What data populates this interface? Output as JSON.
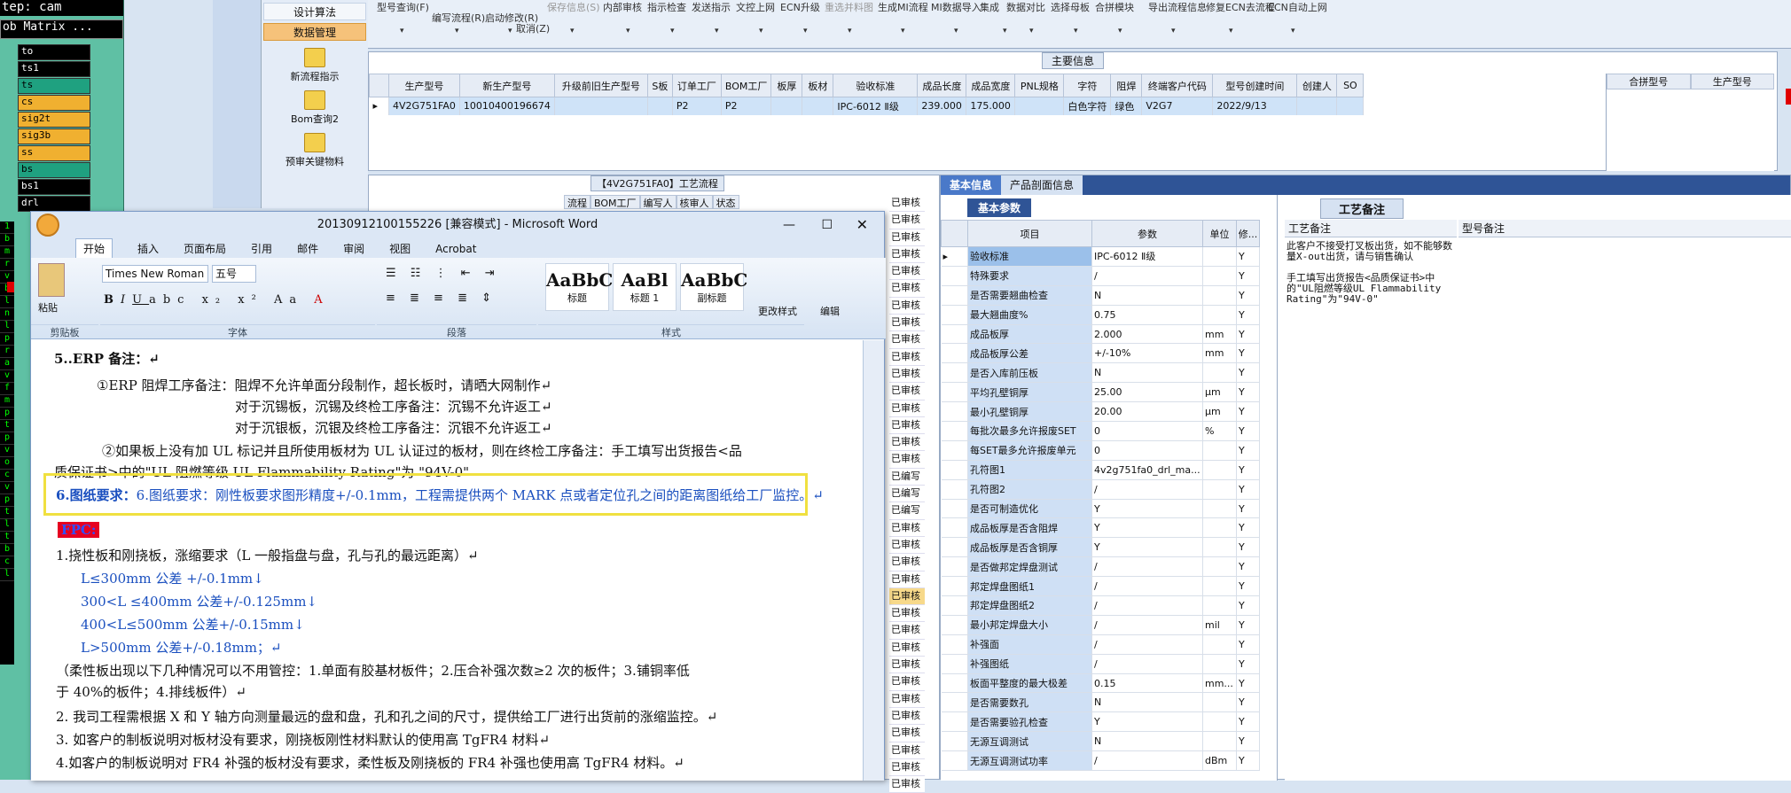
{
  "terminal": {
    "header": "tep: cam",
    "toolbar": "ob Matrix ...",
    "rows": [
      {
        "label": "to",
        "style": "b"
      },
      {
        "label": "ts1",
        "style": "b"
      },
      {
        "label": "ts",
        "style": "t"
      },
      {
        "label": "cs",
        "style": "o"
      },
      {
        "label": "sig2t",
        "style": "o"
      },
      {
        "label": "sig3b",
        "style": "o"
      },
      {
        "label": "ss",
        "style": "o"
      },
      {
        "label": "bs",
        "style": "t"
      },
      {
        "label": "bs1",
        "style": "b"
      },
      {
        "label": "drl",
        "style": "b"
      }
    ],
    "strip": [
      "1",
      "b",
      "m",
      "r",
      "v",
      "b",
      "l",
      "n",
      "l",
      "p",
      "r",
      "a",
      "v",
      "f",
      "m",
      "p",
      "t",
      "p",
      "v",
      "o",
      "c",
      "v",
      "p",
      "t",
      "l",
      "t",
      "b",
      "c",
      "l"
    ]
  },
  "nav": {
    "items": [
      "设计算法",
      "数据管理"
    ],
    "tools": [
      "新流程指示",
      "Bom查询2",
      "预审关键物料"
    ]
  },
  "ribbon": {
    "buttons": [
      {
        "label": "型号查询(F)",
        "grey": false
      },
      {
        "label": "编写流程(R)",
        "grey": false
      },
      {
        "label": "启动修改(R)",
        "grey": false
      },
      {
        "label": "保存信息(S)",
        "grey": true
      },
      {
        "label": "内部审核",
        "grey": false
      },
      {
        "label": "指示检查",
        "grey": false
      },
      {
        "label": "发送指示",
        "grey": false
      },
      {
        "label": "文控上网",
        "grey": false
      },
      {
        "label": "ECN升级",
        "grey": false
      },
      {
        "label": "重选并料图",
        "grey": true
      },
      {
        "label": "生成MI流程",
        "grey": false
      },
      {
        "label": "MI数据导入",
        "grey": false
      },
      {
        "label": "集成",
        "grey": false
      },
      {
        "label": "数据对比",
        "grey": false
      },
      {
        "label": "选择母板",
        "grey": false
      },
      {
        "label": "合拼模块",
        "grey": false
      },
      {
        "label": "导出流程信息",
        "grey": false
      },
      {
        "label": "修复ECN去流程",
        "grey": false
      },
      {
        "label": "ECN自动上网",
        "grey": false
      }
    ],
    "cancel": "取消(Z)"
  },
  "main": {
    "title": "主要信息",
    "columns": [
      "生产型号",
      "新生产型号",
      "升级前旧生产型号",
      "S板",
      "订单工厂",
      "BOM工厂",
      "板厚",
      "板材",
      "验收标准",
      "成品长度",
      "成品宽度",
      "PNL规格",
      "字符",
      "阻焊",
      "终端客户代码",
      "型号创建时间",
      "创建人",
      "SO"
    ],
    "row": [
      "4V2G751FA0",
      "10010400196674",
      "",
      "",
      "P2",
      "P2",
      "",
      "",
      "IPC-6012 Ⅱ级",
      "239.000",
      "175.000",
      "",
      "白色字符",
      "绿色",
      "V2G7",
      "2022/9/13",
      "",
      ""
    ],
    "side_cols": [
      "合拼型号",
      "生产型号"
    ]
  },
  "flow": {
    "title": "【4V2G751FA0】工艺流程",
    "cols": [
      "流程",
      "BOM工厂",
      "编写人",
      "核审人",
      "状态"
    ],
    "status": [
      "已审核",
      "已审核",
      "已审核",
      "已审核",
      "已审核",
      "已审核",
      "已审核",
      "已审核",
      "已审核",
      "已审核",
      "已审核",
      "已审核",
      "已审核",
      "已审核",
      "已审核",
      "已审核",
      "已编写",
      "已编写",
      "已编写",
      "已审核",
      "已审核",
      "已审核",
      "已审核",
      "已审核",
      "已审核",
      "已审核",
      "已审核",
      "已审核",
      "已审核",
      "已审核",
      "已审核",
      "已审核",
      "已审核",
      "已审核",
      "已审核"
    ]
  },
  "word": {
    "title": "20130912100155226 [兼容模式] - Microsoft Word",
    "tabs": [
      "开始",
      "插入",
      "页面布局",
      "引用",
      "邮件",
      "审阅",
      "视图",
      "Acrobat"
    ],
    "font": "Times New Roman",
    "size": "五号",
    "groups": [
      "剪贴板",
      "字体",
      "段落",
      "样式"
    ],
    "paste": "粘贴",
    "change_styles": "更改样式",
    "edit": "编辑",
    "styles": [
      {
        "sample": "AaBbC",
        "name": "标题"
      },
      {
        "sample": "AaBl",
        "name": "标题 1"
      },
      {
        "sample": "AaBbC",
        "name": "副标题"
      }
    ],
    "lines": [
      "5..ERP 备注：↵",
      "①ERP 阻焊工序备注：阻焊不允许单面分段制作，超长板时，请晒大网制作↵",
      "对于沉锡板，沉锡及终检工序备注：沉锡不允许返工↵",
      "对于沉银板，沉银及终检工序备注：沉银不允许返工↵",
      "②如果板上没有加 UL 标记并且所使用板材为 UL 认证过的板材，则在终检工序备注：手工填写出货报告<品",
      "质保证书>中的\"UL 阻燃等级 UL Flammability Rating\"为 \"94V-0\"",
      "6.图纸要求：刚性板要求图形精度+/-0.1mm，工程需提供两个 MARK 点或者定位孔之间的距离图纸给工厂监控。↵",
      "FPC:",
      "1.挠性板和刚挠板，涨缩要求（L 一般指盘与盘，孔与孔的最远距离）↵",
      "L≤300mm 公差 +/-0.1mm↓",
      "300<L ≤400mm 公差+/-0.125mm↓",
      "400<L≤500mm 公差+/-0.15mm↓",
      "L>500mm 公差+/-0.18mm；↵",
      "（柔性板出现以下几种情况可以不用管控：1.单面有胶基材板件；2.压合补强次数≥2 次的板件；3.铺铜率低",
      "于 40%的板件；4.排线板件）↵",
      "2.   我司工程需根据 X 和 Y 轴方向测量最远的盘和盘，孔和孔之间的尺寸，提供给工厂进行出货前的涨缩监控。↵",
      "3. 如客户的制板说明对板材没有要求，刚挠板刚性材料默认的使用高 TgFR4 材料↵",
      "4.如客户的制板说明对 FR4 补强的板材没有要求，柔性板及刚挠板的 FR4 补强也使用高 TgFR4 材料。↵"
    ]
  },
  "right": {
    "tabs": [
      "基本信息",
      "产品剖面信息"
    ],
    "basic_tab": "基本参数",
    "cols": [
      "项目",
      "参数",
      "单位",
      "修..."
    ],
    "params": [
      [
        "验收标准",
        "IPC-6012 Ⅱ级",
        "",
        "Y"
      ],
      [
        "特殊要求",
        "/",
        "",
        "Y"
      ],
      [
        "是否需要翘曲检查",
        "N",
        "",
        "Y"
      ],
      [
        "最大翘曲度%",
        "0.75",
        "",
        "Y"
      ],
      [
        "成品板厚",
        "2.000",
        "mm",
        "Y"
      ],
      [
        "成品板厚公差",
        "+/-10%",
        "mm",
        "Y"
      ],
      [
        "是否入库前压板",
        "N",
        "",
        "Y"
      ],
      [
        "平均孔壁铜厚",
        "25.00",
        "μm",
        "Y"
      ],
      [
        "最小孔壁铜厚",
        "20.00",
        "μm",
        "Y"
      ],
      [
        "每批次最多允许报废SET",
        "0",
        "%",
        "Y"
      ],
      [
        "每SET最多允许报废单元",
        "0",
        "",
        "Y"
      ],
      [
        "孔符图1",
        "4v2g751fa0_drl_ma...",
        "",
        "Y"
      ],
      [
        "孔符图2",
        "/",
        "",
        "Y"
      ],
      [
        "是否可制造优化",
        "Y",
        "",
        "Y"
      ],
      [
        "成品板厚是否含阻焊",
        "Y",
        "",
        "Y"
      ],
      [
        "成品板厚是否含铜厚",
        "Y",
        "",
        "Y"
      ],
      [
        "是否做邦定焊盘测试",
        "/",
        "",
        "Y"
      ],
      [
        "邦定焊盘图纸1",
        "/",
        "",
        "Y"
      ],
      [
        "邦定焊盘图纸2",
        "/",
        "",
        "Y"
      ],
      [
        "最小邦定焊盘大小",
        "/",
        "mil",
        "Y"
      ],
      [
        "补强面",
        "/",
        "",
        "Y"
      ],
      [
        "补强图纸",
        "/",
        "",
        "Y"
      ],
      [
        "板面平整度的最大极差",
        "0.15",
        "mm...",
        "Y"
      ],
      [
        "是否需要数孔",
        "N",
        "",
        "Y"
      ],
      [
        "是否需要验孔检查",
        "Y",
        "",
        "Y"
      ],
      [
        "无源互调测试",
        "N",
        "",
        "Y"
      ],
      [
        "无源互调测试功率",
        "/",
        "dBm",
        "Y"
      ]
    ],
    "notes_tab": "工艺备注",
    "notes_cols": [
      "工艺备注",
      "型号备注"
    ],
    "notes_text": "此客户不接受打叉板出货，如不能够数量X-out出货，请与销售确认\n\n手工填写出货报告<品质保证书>中的\"UL阻燃等级UL Flammability Rating\"为\"94V-0\""
  }
}
